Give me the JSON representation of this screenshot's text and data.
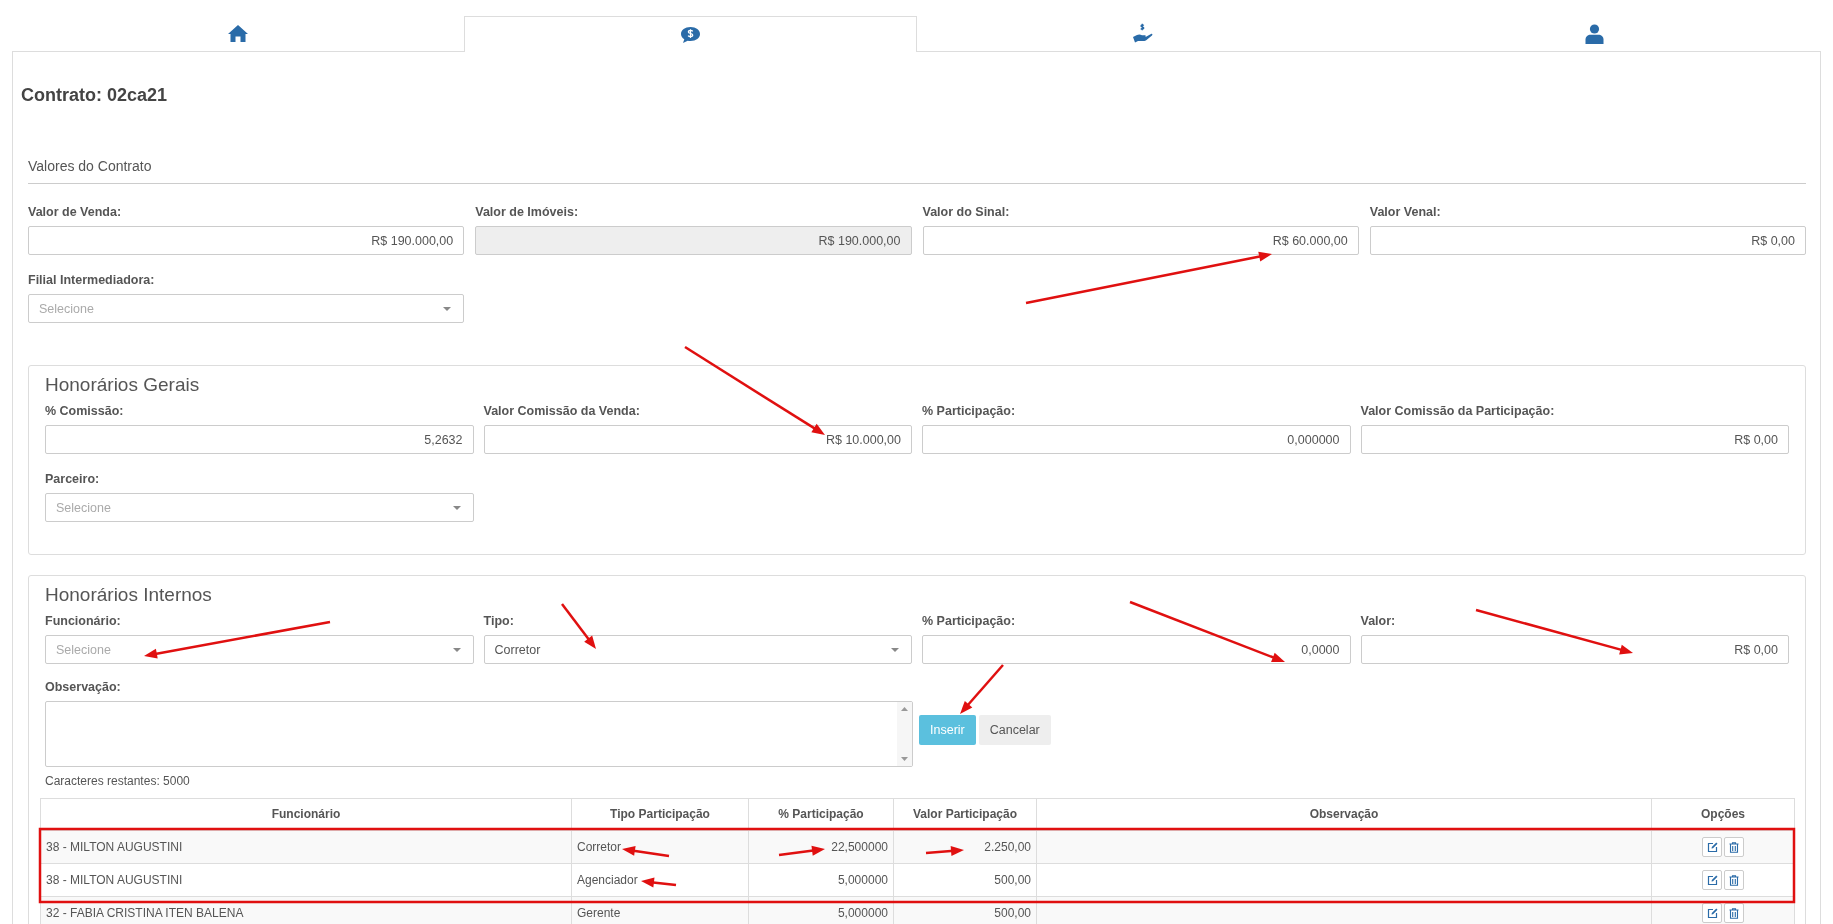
{
  "tabs": [
    {
      "kind": "home",
      "selected": false
    },
    {
      "kind": "money-chat",
      "selected": true
    },
    {
      "kind": "hand-money",
      "selected": false
    },
    {
      "kind": "user",
      "selected": false
    }
  ],
  "title": "Contrato: 02ca21",
  "valores": {
    "heading": "Valores do Contrato",
    "fields": [
      {
        "label": "Valor de Venda:",
        "value": "R$ 190.000,00",
        "disabled": false
      },
      {
        "label": "Valor de Imóveis:",
        "value": "R$ 190.000,00",
        "disabled": true
      },
      {
        "label": "Valor do Sinal:",
        "value": "R$ 60.000,00",
        "disabled": false
      },
      {
        "label": "Valor Venal:",
        "value": "R$ 0,00",
        "disabled": false
      }
    ],
    "filial": {
      "label": "Filial Intermediadora:",
      "placeholder": "Selecione"
    }
  },
  "gerais": {
    "heading": "Honorários Gerais",
    "fields": [
      {
        "label": "% Comissão:",
        "value": "5,2632"
      },
      {
        "label": "Valor Comissão da Venda:",
        "value": "R$ 10.000,00"
      },
      {
        "label": "% Participação:",
        "value": "0,000000"
      },
      {
        "label": "Valor Comissão da Participação:",
        "value": "R$ 0,00"
      }
    ],
    "parceiro": {
      "label": "Parceiro:",
      "placeholder": "Selecione"
    }
  },
  "internos": {
    "heading": "Honorários Internos",
    "funcionario": {
      "label": "Funcionário:",
      "placeholder": "Selecione"
    },
    "tipo": {
      "label": "Tipo:",
      "value": "Corretor"
    },
    "participacao": {
      "label": "% Participação:",
      "value": "0,0000"
    },
    "valor": {
      "label": "Valor:",
      "value": "R$ 0,00"
    },
    "observacao": {
      "label": "Observação:"
    },
    "buttons": [
      "Inserir",
      "Cancelar"
    ],
    "remaining": "Caracteres restantes: 5000"
  },
  "table": {
    "columns": [
      "Funcionário",
      "Tipo Participação",
      "% Participação",
      "Valor Participação",
      "Observação",
      "Opções"
    ],
    "rows": [
      {
        "funcionario": "38 - MILTON AUGUSTINI",
        "tipo": "Corretor",
        "participacao": "22,500000",
        "valor": "2.250,00"
      },
      {
        "funcionario": "38 - MILTON AUGUSTINI",
        "tipo": "Agenciador",
        "participacao": "5,000000",
        "valor": "500,00"
      },
      {
        "funcionario": "32 - FABIA CRISTINA ITEN BALENA",
        "tipo": "Gerente",
        "participacao": "5,000000",
        "valor": "500,00"
      }
    ]
  }
}
